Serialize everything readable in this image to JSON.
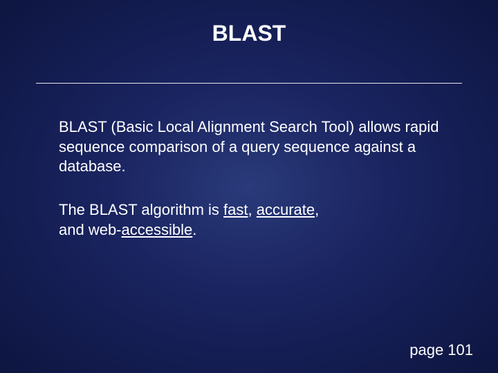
{
  "title": "BLAST",
  "para1": "BLAST (Basic Local Alignment Search Tool) allows rapid sequence comparison of a query sequence against a database.",
  "para2_prefix": "The BLAST algorithm is ",
  "para2_word1": "fast",
  "para2_sep1": ", ",
  "para2_word2": "accurate",
  "para2_sep2": ",",
  "para2_line2_prefix": "and web-",
  "para2_word3": "accessible",
  "para2_suffix": ".",
  "page_label": "page 101"
}
